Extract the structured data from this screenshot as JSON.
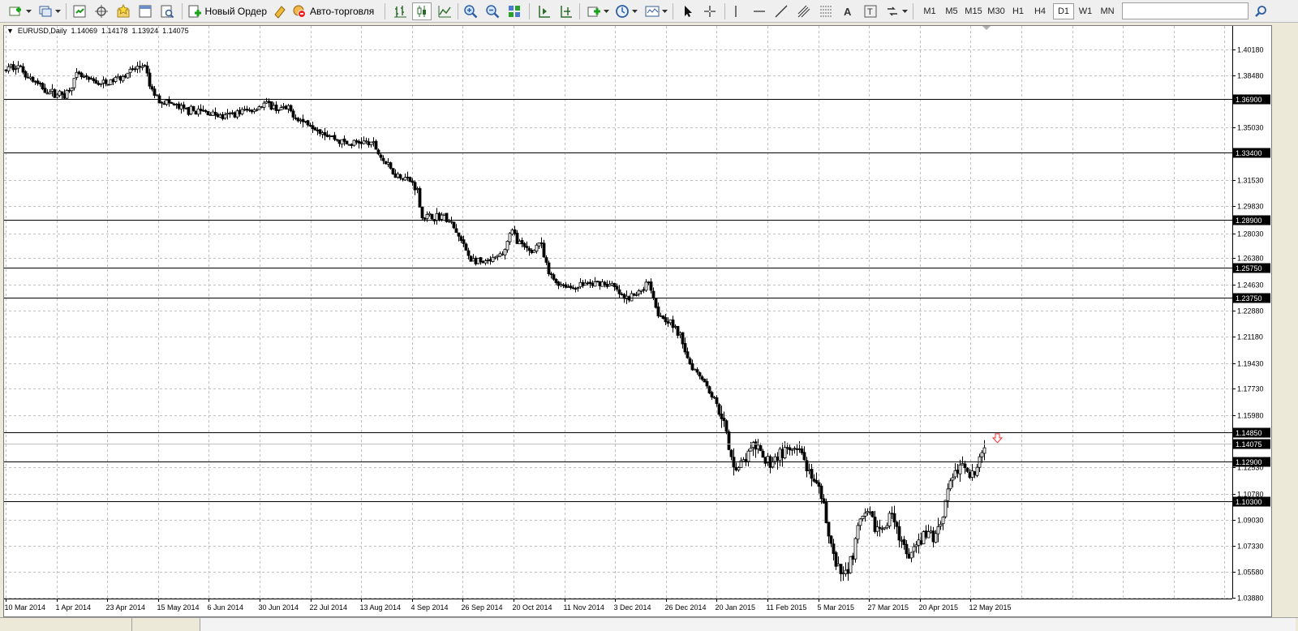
{
  "toolbar": {
    "new_order_label": "Новый Ордер",
    "auto_trading_label": "Авто-торговля",
    "timeframes": [
      "M1",
      "M5",
      "M15",
      "M30",
      "H1",
      "H4",
      "D1",
      "W1",
      "MN"
    ],
    "active_timeframe": "D1"
  },
  "chart_header": {
    "symbol": "EURUSD,Daily",
    "open": "1.14069",
    "high": "1.14178",
    "low": "1.13924",
    "close": "1.14075"
  },
  "chart_data": {
    "type": "candlestick",
    "symbol": "EURUSD",
    "timeframe": "Daily",
    "ylim": [
      1.0388,
      1.4182
    ],
    "grid": true,
    "y_ticks": [
      "1.40180",
      "1.38480",
      "1.35030",
      "1.31530",
      "1.29830",
      "1.28030",
      "1.26380",
      "1.24630",
      "1.22880",
      "1.21180",
      "1.19430",
      "1.17730",
      "1.15980",
      "1.12530",
      "1.10780",
      "1.09030",
      "1.07330",
      "1.05580",
      "1.03880"
    ],
    "x_tick_labels": [
      "10 Mar 2014",
      "1 Apr 2014",
      "23 Apr 2014",
      "15 May 2014",
      "6 Jun 2014",
      "30 Jun 2014",
      "22 Jul 2014",
      "13 Aug 2014",
      "4 Sep 2014",
      "26 Sep 2014",
      "20 Oct 2014",
      "11 Nov 2014",
      "3 Dec 2014",
      "26 Dec 2014",
      "20 Jan 2015",
      "11 Feb 2015",
      "5 Mar 2015",
      "27 Mar 2015",
      "20 Apr 2015",
      "12 May 2015"
    ],
    "horizontal_levels": [
      1.369,
      1.334,
      1.289,
      1.2575,
      1.2375,
      1.1485,
      1.129,
      1.103
    ],
    "current_price": 1.14075,
    "current_price_label": "1.14075",
    "price_path": [
      [
        0,
        1.388
      ],
      [
        15,
        1.392
      ],
      [
        30,
        1.384
      ],
      [
        45,
        1.377
      ],
      [
        60,
        1.373
      ],
      [
        75,
        1.372
      ],
      [
        90,
        1.385
      ],
      [
        105,
        1.381
      ],
      [
        125,
        1.379
      ],
      [
        150,
        1.386
      ],
      [
        165,
        1.39
      ],
      [
        172,
        1.392
      ],
      [
        180,
        1.376
      ],
      [
        190,
        1.369
      ],
      [
        205,
        1.366
      ],
      [
        220,
        1.362
      ],
      [
        240,
        1.361
      ],
      [
        255,
        1.36
      ],
      [
        270,
        1.357
      ],
      [
        290,
        1.361
      ],
      [
        305,
        1.362
      ],
      [
        320,
        1.366
      ],
      [
        335,
        1.363
      ],
      [
        350,
        1.362
      ],
      [
        365,
        1.355
      ],
      [
        380,
        1.352
      ],
      [
        395,
        1.347
      ],
      [
        410,
        1.342
      ],
      [
        425,
        1.339
      ],
      [
        440,
        1.341
      ],
      [
        455,
        1.339
      ],
      [
        465,
        1.33
      ],
      [
        480,
        1.32
      ],
      [
        495,
        1.317
      ],
      [
        508,
        1.311
      ],
      [
        515,
        1.291
      ],
      [
        530,
        1.291
      ],
      [
        540,
        1.292
      ],
      [
        550,
        1.287
      ],
      [
        565,
        1.273
      ],
      [
        575,
        1.263
      ],
      [
        590,
        1.26
      ],
      [
        605,
        1.263
      ],
      [
        615,
        1.267
      ],
      [
        625,
        1.282
      ],
      [
        640,
        1.27
      ],
      [
        650,
        1.268
      ],
      [
        660,
        1.275
      ],
      [
        670,
        1.254
      ],
      [
        680,
        1.248
      ],
      [
        690,
        1.246
      ],
      [
        700,
        1.244
      ],
      [
        715,
        1.247
      ],
      [
        725,
        1.246
      ],
      [
        735,
        1.248
      ],
      [
        750,
        1.245
      ],
      [
        765,
        1.236
      ],
      [
        780,
        1.24
      ],
      [
        795,
        1.249
      ],
      [
        805,
        1.228
      ],
      [
        820,
        1.222
      ],
      [
        835,
        1.21
      ],
      [
        845,
        1.194
      ],
      [
        860,
        1.185
      ],
      [
        875,
        1.17
      ],
      [
        885,
        1.16
      ],
      [
        895,
        1.131
      ],
      [
        905,
        1.125
      ],
      [
        915,
        1.132
      ],
      [
        925,
        1.14
      ],
      [
        935,
        1.13
      ],
      [
        945,
        1.129
      ],
      [
        955,
        1.134
      ],
      [
        970,
        1.136
      ],
      [
        985,
        1.133
      ],
      [
        995,
        1.114
      ],
      [
        1005,
        1.109
      ],
      [
        1015,
        1.086
      ],
      [
        1025,
        1.058
      ],
      [
        1035,
        1.053
      ],
      [
        1045,
        1.066
      ],
      [
        1055,
        1.09
      ],
      [
        1065,
        1.093
      ],
      [
        1075,
        1.085
      ],
      [
        1085,
        1.083
      ],
      [
        1095,
        1.098
      ],
      [
        1105,
        1.075
      ],
      [
        1115,
        1.064
      ],
      [
        1125,
        1.073
      ],
      [
        1135,
        1.081
      ],
      [
        1145,
        1.079
      ],
      [
        1155,
        1.09
      ],
      [
        1165,
        1.117
      ],
      [
        1175,
        1.123
      ],
      [
        1185,
        1.127
      ],
      [
        1195,
        1.119
      ],
      [
        1205,
        1.133
      ],
      [
        1210,
        1.14
      ]
    ]
  },
  "colors": {
    "grid": "#c0c0c0",
    "candle": "#000000",
    "level_line": "#000000",
    "current_line": "#c0c0c0",
    "sell_arrow": "#ff3030",
    "bg": "#ffffff"
  }
}
